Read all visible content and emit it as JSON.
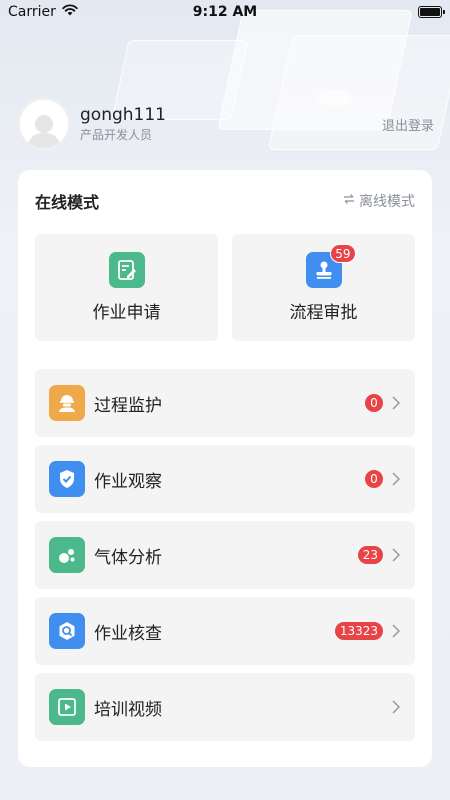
{
  "status_bar": {
    "carrier": "Carrier",
    "time": "9:12 AM"
  },
  "user": {
    "name": "gongh111",
    "role": "产品开发人员",
    "logout_label": "退出登录"
  },
  "card": {
    "mode_title": "在线模式",
    "offline_label": "离线模式",
    "tiles": [
      {
        "label": "作业申请",
        "icon": "edit-doc-icon",
        "color": "#4cb98a",
        "badge": ""
      },
      {
        "label": "流程审批",
        "icon": "stamp-icon",
        "color": "#3f8ef0",
        "badge": "59"
      }
    ],
    "rows": [
      {
        "label": "过程监护",
        "icon": "worker-helmet-icon",
        "color": "#f0a94a",
        "badge": "0"
      },
      {
        "label": "作业观察",
        "icon": "shield-check-icon",
        "color": "#3f8ef0",
        "badge": "0"
      },
      {
        "label": "气体分析",
        "icon": "gas-bubbles-icon",
        "color": "#4cb98a",
        "badge": "23"
      },
      {
        "label": "作业核查",
        "icon": "inspect-search-icon",
        "color": "#3f8ef0",
        "badge": "13323"
      },
      {
        "label": "培训视频",
        "icon": "video-play-icon",
        "color": "#4cb98a",
        "badge": ""
      }
    ]
  },
  "colors": {
    "badge_red": "#e84448",
    "text_muted": "#8a8f99"
  }
}
